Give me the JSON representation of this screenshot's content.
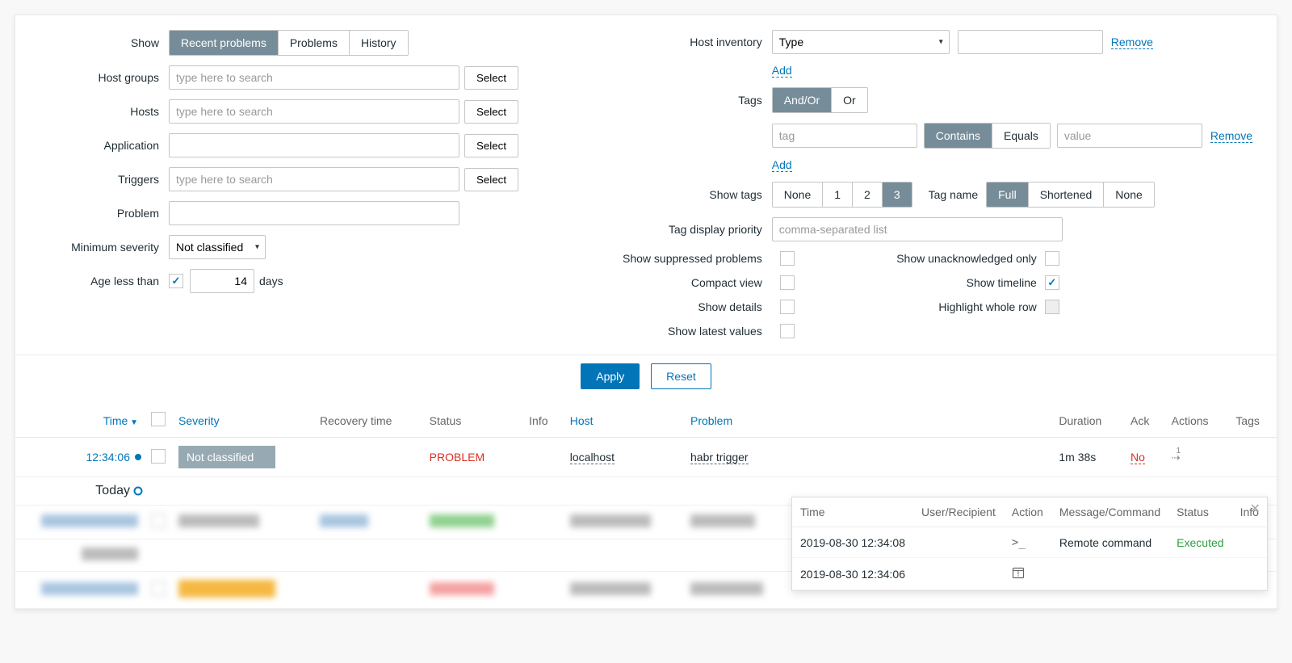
{
  "filter": {
    "show_label": "Show",
    "show_opts": [
      "Recent problems",
      "Problems",
      "History"
    ],
    "host_groups_label": "Host groups",
    "hosts_label": "Hosts",
    "application_label": "Application",
    "triggers_label": "Triggers",
    "problem_label": "Problem",
    "min_sev_label": "Minimum severity",
    "min_sev_value": "Not classified",
    "age_label": "Age less than",
    "age_value": "14",
    "age_unit": "days",
    "search_ph": "type here to search",
    "select_btn": "Select",
    "host_inv_label": "Host inventory",
    "host_inv_type": "Type",
    "remove": "Remove",
    "add": "Add",
    "tags_label": "Tags",
    "tags_mode": [
      "And/Or",
      "Or"
    ],
    "tag_ph": "tag",
    "tag_ops": [
      "Contains",
      "Equals"
    ],
    "value_ph": "value",
    "show_tags_label": "Show tags",
    "show_tags_opts": [
      "None",
      "1",
      "2",
      "3"
    ],
    "tag_name_label": "Tag name",
    "tag_name_opts": [
      "Full",
      "Shortened",
      "None"
    ],
    "tag_prio_label": "Tag display priority",
    "tag_prio_ph": "comma-separated list",
    "suppressed_label": "Show suppressed problems",
    "unack_label": "Show unacknowledged only",
    "compact_label": "Compact view",
    "timeline_label": "Show timeline",
    "details_label": "Show details",
    "highlight_label": "Highlight whole row",
    "latest_label": "Show latest values",
    "apply": "Apply",
    "reset": "Reset"
  },
  "table": {
    "headers": {
      "time": "Time",
      "severity": "Severity",
      "recovery": "Recovery time",
      "status": "Status",
      "info": "Info",
      "host": "Host",
      "problem": "Problem",
      "duration": "Duration",
      "ack": "Ack",
      "actions": "Actions",
      "tags": "Tags"
    },
    "row1": {
      "time": "12:34:06",
      "severity": "Not classified",
      "status": "PROBLEM",
      "host": "localhost",
      "problem": "habr trigger",
      "duration": "1m 38s",
      "ack": "No",
      "actions_count": "1"
    },
    "today": "Today"
  },
  "popup": {
    "headers": {
      "time": "Time",
      "user": "User/Recipient",
      "action": "Action",
      "message": "Message/Command",
      "status": "Status",
      "info": "Info"
    },
    "rows": [
      {
        "time": "2019-08-30 12:34:08",
        "action_icon": ">_",
        "message": "Remote command",
        "status": "Executed"
      },
      {
        "time": "2019-08-30 12:34:06",
        "action_icon": "cal"
      }
    ]
  }
}
